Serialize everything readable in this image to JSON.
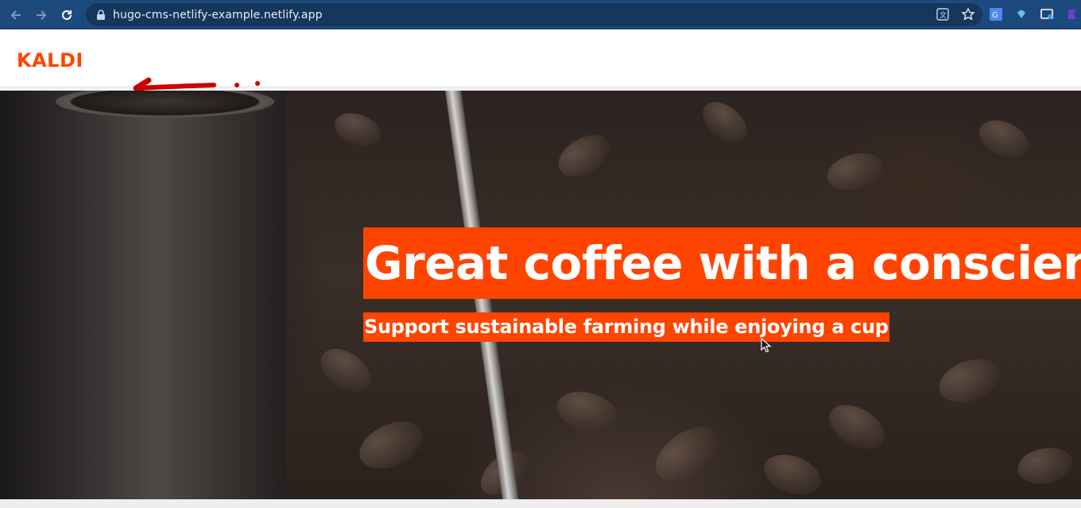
{
  "browser": {
    "url": "hugo-cms-netlify-example.netlify.app",
    "icons": [
      "back-icon",
      "forward-icon",
      "reload-icon",
      "lock-icon",
      "translate-icon",
      "bookmark-star-icon",
      "google-translate-extension-icon",
      "gem-extension-icon",
      "window-extension-icon"
    ]
  },
  "site": {
    "logo": "KALDI",
    "annotation_color": "#cc0000",
    "brand_color": "#ff4400"
  },
  "hero": {
    "title": "Great coffee with a conscience",
    "subtitle": "Support sustainable farming while enjoying a cup"
  }
}
